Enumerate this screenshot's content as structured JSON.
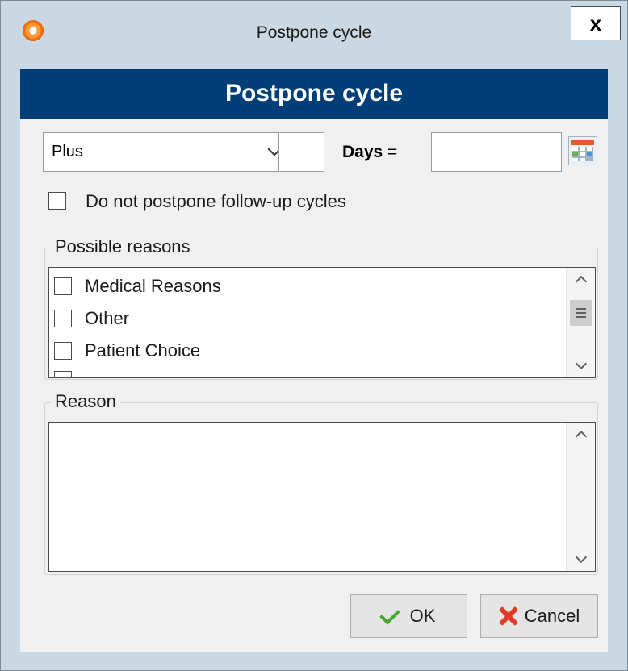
{
  "window": {
    "title": "Postpone cycle",
    "close_label": "x"
  },
  "header": {
    "title": "Postpone cycle"
  },
  "offset": {
    "mode_selected": "Plus",
    "amount_value": "",
    "unit_label": "Days",
    "equals": "=",
    "result_date_value": ""
  },
  "options": {
    "no_followup_label": "Do not postpone follow-up cycles",
    "no_followup_checked": false
  },
  "possible_reasons": {
    "title": "Possible reasons",
    "items": [
      {
        "label": "Medical Reasons",
        "checked": false
      },
      {
        "label": "Other",
        "checked": false
      },
      {
        "label": "Patient Choice",
        "checked": false
      }
    ]
  },
  "reason": {
    "title": "Reason",
    "value": ""
  },
  "buttons": {
    "ok_label": "OK",
    "cancel_label": "Cancel"
  },
  "colors": {
    "banner": "#003e78",
    "window_frame": "#c9d8e2",
    "ok_check": "#43a92b",
    "cancel_x": "#e23a2a"
  }
}
